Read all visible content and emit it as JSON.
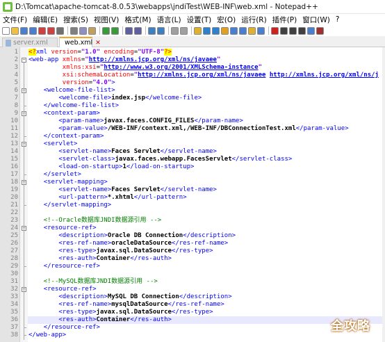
{
  "window": {
    "title": "D:\\Tomcat\\apache-tomcat-8.0.53\\webapps\\jndiTest\\WEB-INF\\web.xml - Notepad++"
  },
  "menu": [
    "文件(F)",
    "编辑(E)",
    "搜索(S)",
    "视图(V)",
    "格式(M)",
    "语言(L)",
    "设置(T)",
    "宏(O)",
    "运行(R)",
    "插件(P)",
    "窗口(W)",
    "?"
  ],
  "tabs": [
    {
      "label": "server.xml",
      "active": false
    },
    {
      "label": "web.xml",
      "active": true
    }
  ],
  "toolbar_icons": [
    "new-file-icon",
    "open-file-icon",
    "save-icon",
    "save-all-icon",
    "close-icon",
    "close-all-icon",
    "print-icon",
    "cut-icon",
    "copy-icon",
    "paste-icon",
    "undo-icon",
    "redo-icon",
    "find-icon",
    "replace-icon",
    "zoom-in-icon",
    "zoom-out-icon",
    "sync-v-icon",
    "sync-h-icon",
    "word-wrap-icon",
    "all-chars-icon",
    "indent-guide-icon",
    "udl-icon",
    "doc-map-icon",
    "func-list-icon",
    "folder-workspace-icon",
    "monitor-icon",
    "record-macro-icon",
    "stop-macro-icon",
    "play-macro-icon",
    "run-macro-icon",
    "save-macro-icon",
    "abc-spell-icon"
  ],
  "colors": {
    "tag": "#0000ff",
    "attribute": "#ff0000",
    "value": "#8000ff",
    "comment": "#008000",
    "active_tab_accent": "#f5a623",
    "current_line": "#e8e8ff"
  },
  "lines": [
    {
      "n": "1",
      "html": "<span class=\"pi\">&lt;?</span><span class=\"tag\">xml</span> <span class=\"attr\">version</span>=<span class=\"val\">\"1.0\"</span> <span class=\"attr\">encoding</span>=<span class=\"val\">\"UTF-8\"</span><span class=\"pi\">?&gt;</span>"
    },
    {
      "n": "2",
      "html": "<span class=\"tag\">&lt;web-app</span> <span class=\"attr\">xmlns</span>=<span class=\"val\">\"<span class=\"link\">http://xmlns.jcp.org/xml/ns/javaee</span>\"</span>"
    },
    {
      "n": "3",
      "html": "         <span class=\"attr\">xmlns:xsi</span>=<span class=\"val\">\"<span class=\"link\">http://www.w3.org/2001/XMLSchema-instance</span>\"</span>"
    },
    {
      "n": "4",
      "html": "         <span class=\"attr\">xsi:schemaLocation</span>=<span class=\"val\">\"<span class=\"link\">http://xmlns.jcp.org/xml/ns/javaee</span> <span class=\"link\">http://xmlns.jcp.org/xml/ns/j</span></span>"
    },
    {
      "n": "5",
      "html": "         <span class=\"attr\">version</span>=<span class=\"val\">\"4.0\"</span><span class=\"tag\">&gt;</span>"
    },
    {
      "n": "6",
      "html": "    <span class=\"tag\">&lt;welcome-file-list&gt;</span>"
    },
    {
      "n": "7",
      "html": "        <span class=\"tag\">&lt;welcome-file&gt;</span><span class=\"txt\">index.jsp</span><span class=\"tag\">&lt;/welcome-file&gt;</span>"
    },
    {
      "n": "8",
      "html": "    <span class=\"tag\">&lt;/welcome-file-list&gt;</span>"
    },
    {
      "n": "9",
      "html": "    <span class=\"tag\">&lt;context-param&gt;</span>"
    },
    {
      "n": "10",
      "html": "        <span class=\"tag\">&lt;param-name&gt;</span><span class=\"txt\">javax.faces.CONFIG_FILES</span><span class=\"tag\">&lt;/param-name&gt;</span>"
    },
    {
      "n": "11",
      "html": "        <span class=\"tag\">&lt;param-value&gt;</span><span class=\"txt\">/WEB-INF/context.xml,/WEB-INF/DBConnectionTest.xml</span><span class=\"tag\">&lt;/param-value&gt;</span>"
    },
    {
      "n": "12",
      "html": "    <span class=\"tag\">&lt;/context-param&gt;</span>"
    },
    {
      "n": "13",
      "html": "    <span class=\"tag\">&lt;servlet&gt;</span>"
    },
    {
      "n": "14",
      "html": "        <span class=\"tag\">&lt;servlet-name&gt;</span><span class=\"txt\">Faces Servlet</span><span class=\"tag\">&lt;/servlet-name&gt;</span>"
    },
    {
      "n": "15",
      "html": "        <span class=\"tag\">&lt;servlet-class&gt;</span><span class=\"txt\">javax.faces.webapp.FacesServlet</span><span class=\"tag\">&lt;/servlet-class&gt;</span>"
    },
    {
      "n": "16",
      "html": "        <span class=\"tag\">&lt;load-on-startup&gt;</span><span class=\"txt\">1</span><span class=\"tag\">&lt;/load-on-startup&gt;</span>"
    },
    {
      "n": "17",
      "html": "    <span class=\"tag\">&lt;/servlet&gt;</span>"
    },
    {
      "n": "18",
      "html": "    <span class=\"tag\">&lt;servlet-mapping&gt;</span>"
    },
    {
      "n": "19",
      "html": "        <span class=\"tag\">&lt;servlet-name&gt;</span><span class=\"txt\">Faces Servlet</span><span class=\"tag\">&lt;/servlet-name&gt;</span>"
    },
    {
      "n": "20",
      "html": "        <span class=\"tag\">&lt;url-pattern&gt;</span><span class=\"txt\">*.xhtml</span><span class=\"tag\">&lt;/url-pattern&gt;</span>"
    },
    {
      "n": "21",
      "html": "    <span class=\"tag\">&lt;/servlet-mapping&gt;</span>"
    },
    {
      "n": "22",
      "html": ""
    },
    {
      "n": "23",
      "html": "    <span class=\"cmt\">&lt;!--Oracle数据库JNDI数据源引用 --&gt;</span>"
    },
    {
      "n": "24",
      "html": "    <span class=\"tag\">&lt;resource-ref&gt;</span>"
    },
    {
      "n": "25",
      "html": "        <span class=\"tag\">&lt;description&gt;</span><span class=\"txt\">Oracle DB Connection</span><span class=\"tag\">&lt;/description&gt;</span>"
    },
    {
      "n": "26",
      "html": "        <span class=\"tag\">&lt;res-ref-name&gt;</span><span class=\"txt\">oracleDataSource</span><span class=\"tag\">&lt;/res-ref-name&gt;</span>"
    },
    {
      "n": "27",
      "html": "        <span class=\"tag\">&lt;res-type&gt;</span><span class=\"txt\">javax.sql.DataSource</span><span class=\"tag\">&lt;/res-type&gt;</span>"
    },
    {
      "n": "28",
      "html": "        <span class=\"tag\">&lt;res-auth&gt;</span><span class=\"txt\">Container</span><span class=\"tag\">&lt;/res-auth&gt;</span>"
    },
    {
      "n": "29",
      "html": "    <span class=\"tag\">&lt;/resource-ref&gt;</span>"
    },
    {
      "n": "30",
      "html": ""
    },
    {
      "n": "31",
      "html": "    <span class=\"cmt\">&lt;!--MySQL数据库JNDI数据源引用 --&gt;</span>"
    },
    {
      "n": "32",
      "html": "    <span class=\"tag\">&lt;resource-ref&gt;</span>"
    },
    {
      "n": "33",
      "html": "        <span class=\"tag\">&lt;description&gt;</span><span class=\"txt\">MySQL DB Connection</span><span class=\"tag\">&lt;/description&gt;</span>"
    },
    {
      "n": "34",
      "html": "        <span class=\"tag\">&lt;res-ref-name&gt;</span><span class=\"txt\">mysqlDataSource</span><span class=\"tag\">&lt;/res-ref-name&gt;</span>"
    },
    {
      "n": "35",
      "html": "        <span class=\"tag\">&lt;res-type&gt;</span><span class=\"txt\">javax.sql.DataSource</span><span class=\"tag\">&lt;/res-type&gt;</span>"
    },
    {
      "n": "36",
      "html": "        <span class=\"tag\">&lt;res-auth&gt;</span><span class=\"txt\">Container</span><span class=\"tag\">&lt;/res-auth&gt;</span>"
    },
    {
      "n": "37",
      "html": "    <span class=\"tag\">&lt;/resource-ref&gt;</span>"
    },
    {
      "n": "38",
      "html": "<span class=\"tag\">&lt;/web-app&gt;</span>"
    }
  ],
  "current_line": 36,
  "watermark": "全攻略"
}
